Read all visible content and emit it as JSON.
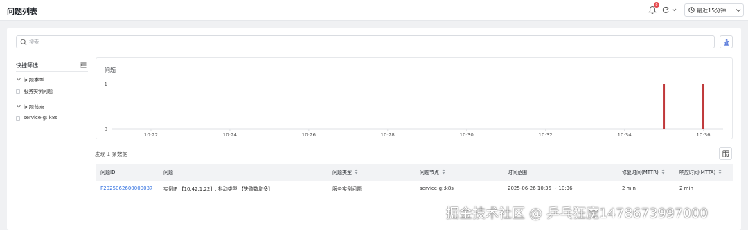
{
  "header": {
    "title": "问题列表",
    "notification_count": "8",
    "time_range_label": "最近15分钟"
  },
  "search": {
    "placeholder": "搜索",
    "value": ""
  },
  "sidebar": {
    "title": "快捷筛选",
    "groups": [
      {
        "label": "问题类型",
        "options": [
          "服务实例问题"
        ]
      },
      {
        "label": "问题节点",
        "options": [
          "service-g::k8s"
        ]
      }
    ]
  },
  "chart_data": {
    "type": "bar",
    "title": "问题",
    "x_tick_labels": [
      "10:22",
      "10:24",
      "10:26",
      "10:28",
      "10:30",
      "10:32",
      "10:34",
      "10:36"
    ],
    "y_tick_labels": [
      "0",
      "1"
    ],
    "ylim": [
      0,
      1
    ],
    "xlim_minutes": [
      "10:21",
      "10:36:30"
    ],
    "series": [
      {
        "values": [
          {
            "x": "10:35",
            "y": 1
          },
          {
            "x": "10:36",
            "y": 1
          }
        ]
      }
    ],
    "bar_color": "#c0393b",
    "grid": false
  },
  "results": {
    "summary": "发现 1 条数据"
  },
  "table": {
    "columns": [
      {
        "label": "问题ID",
        "sortable": false
      },
      {
        "label": "问题",
        "sortable": false
      },
      {
        "label": "问题类型",
        "sortable": true
      },
      {
        "label": "问题节点",
        "sortable": true
      },
      {
        "label": "时间范围",
        "sortable": false
      },
      {
        "label": "修复时间(MTTR)",
        "sortable": true
      },
      {
        "label": "响应时间(MTTA)",
        "sortable": true
      }
    ],
    "rows": [
      {
        "id": "P2025062600000037",
        "problem": "实例IP 【10.42.1.22】, 抖动类型 【失败数增多】",
        "type": "服务实例问题",
        "node": "service-g::k8s",
        "time_range": "2025-06-26 10:35 ~ 10:36",
        "mttr": "2 min",
        "mtta": "2 min"
      }
    ]
  },
  "watermark": "掘金技术社区 @ 乒乓狂魔1478673997000",
  "colors": {
    "link": "#2f6fe0",
    "badge": "#e5484d",
    "bar": "#c0393b"
  }
}
